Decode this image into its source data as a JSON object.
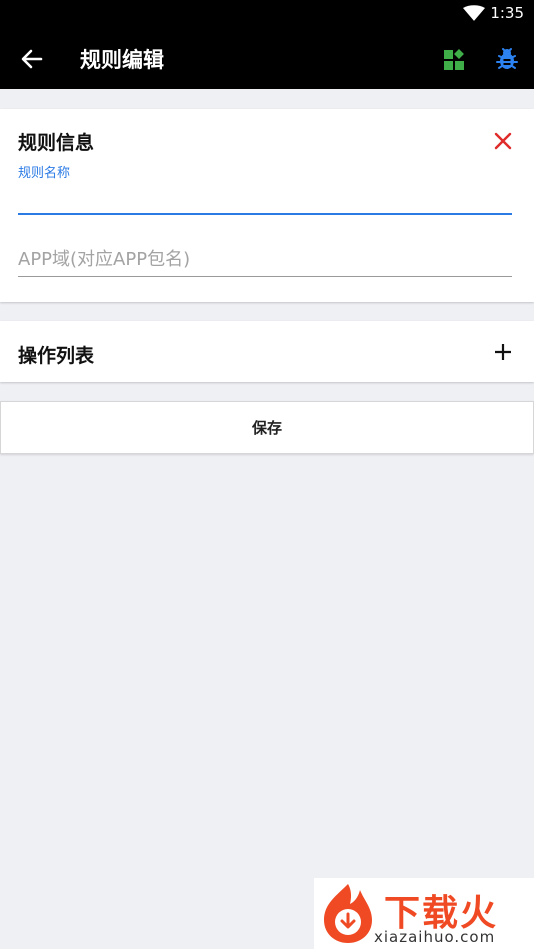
{
  "status_bar": {
    "time": "1:35"
  },
  "toolbar": {
    "title": "规则编辑"
  },
  "rule_info": {
    "title": "规则信息",
    "name_label": "规则名称",
    "name_value": "",
    "app_placeholder": "APP域(对应APP包名)"
  },
  "actions": {
    "title": "操作列表"
  },
  "save": {
    "label": "保存"
  },
  "watermark": {
    "brand": "下载火",
    "url": "xiazaihuo.com"
  },
  "colors": {
    "accent": "#2c7be5",
    "close": "#e02b2b",
    "apps_icon": "#3fae49",
    "bug_icon": "#2c82f0",
    "brand": "#f04a24"
  }
}
